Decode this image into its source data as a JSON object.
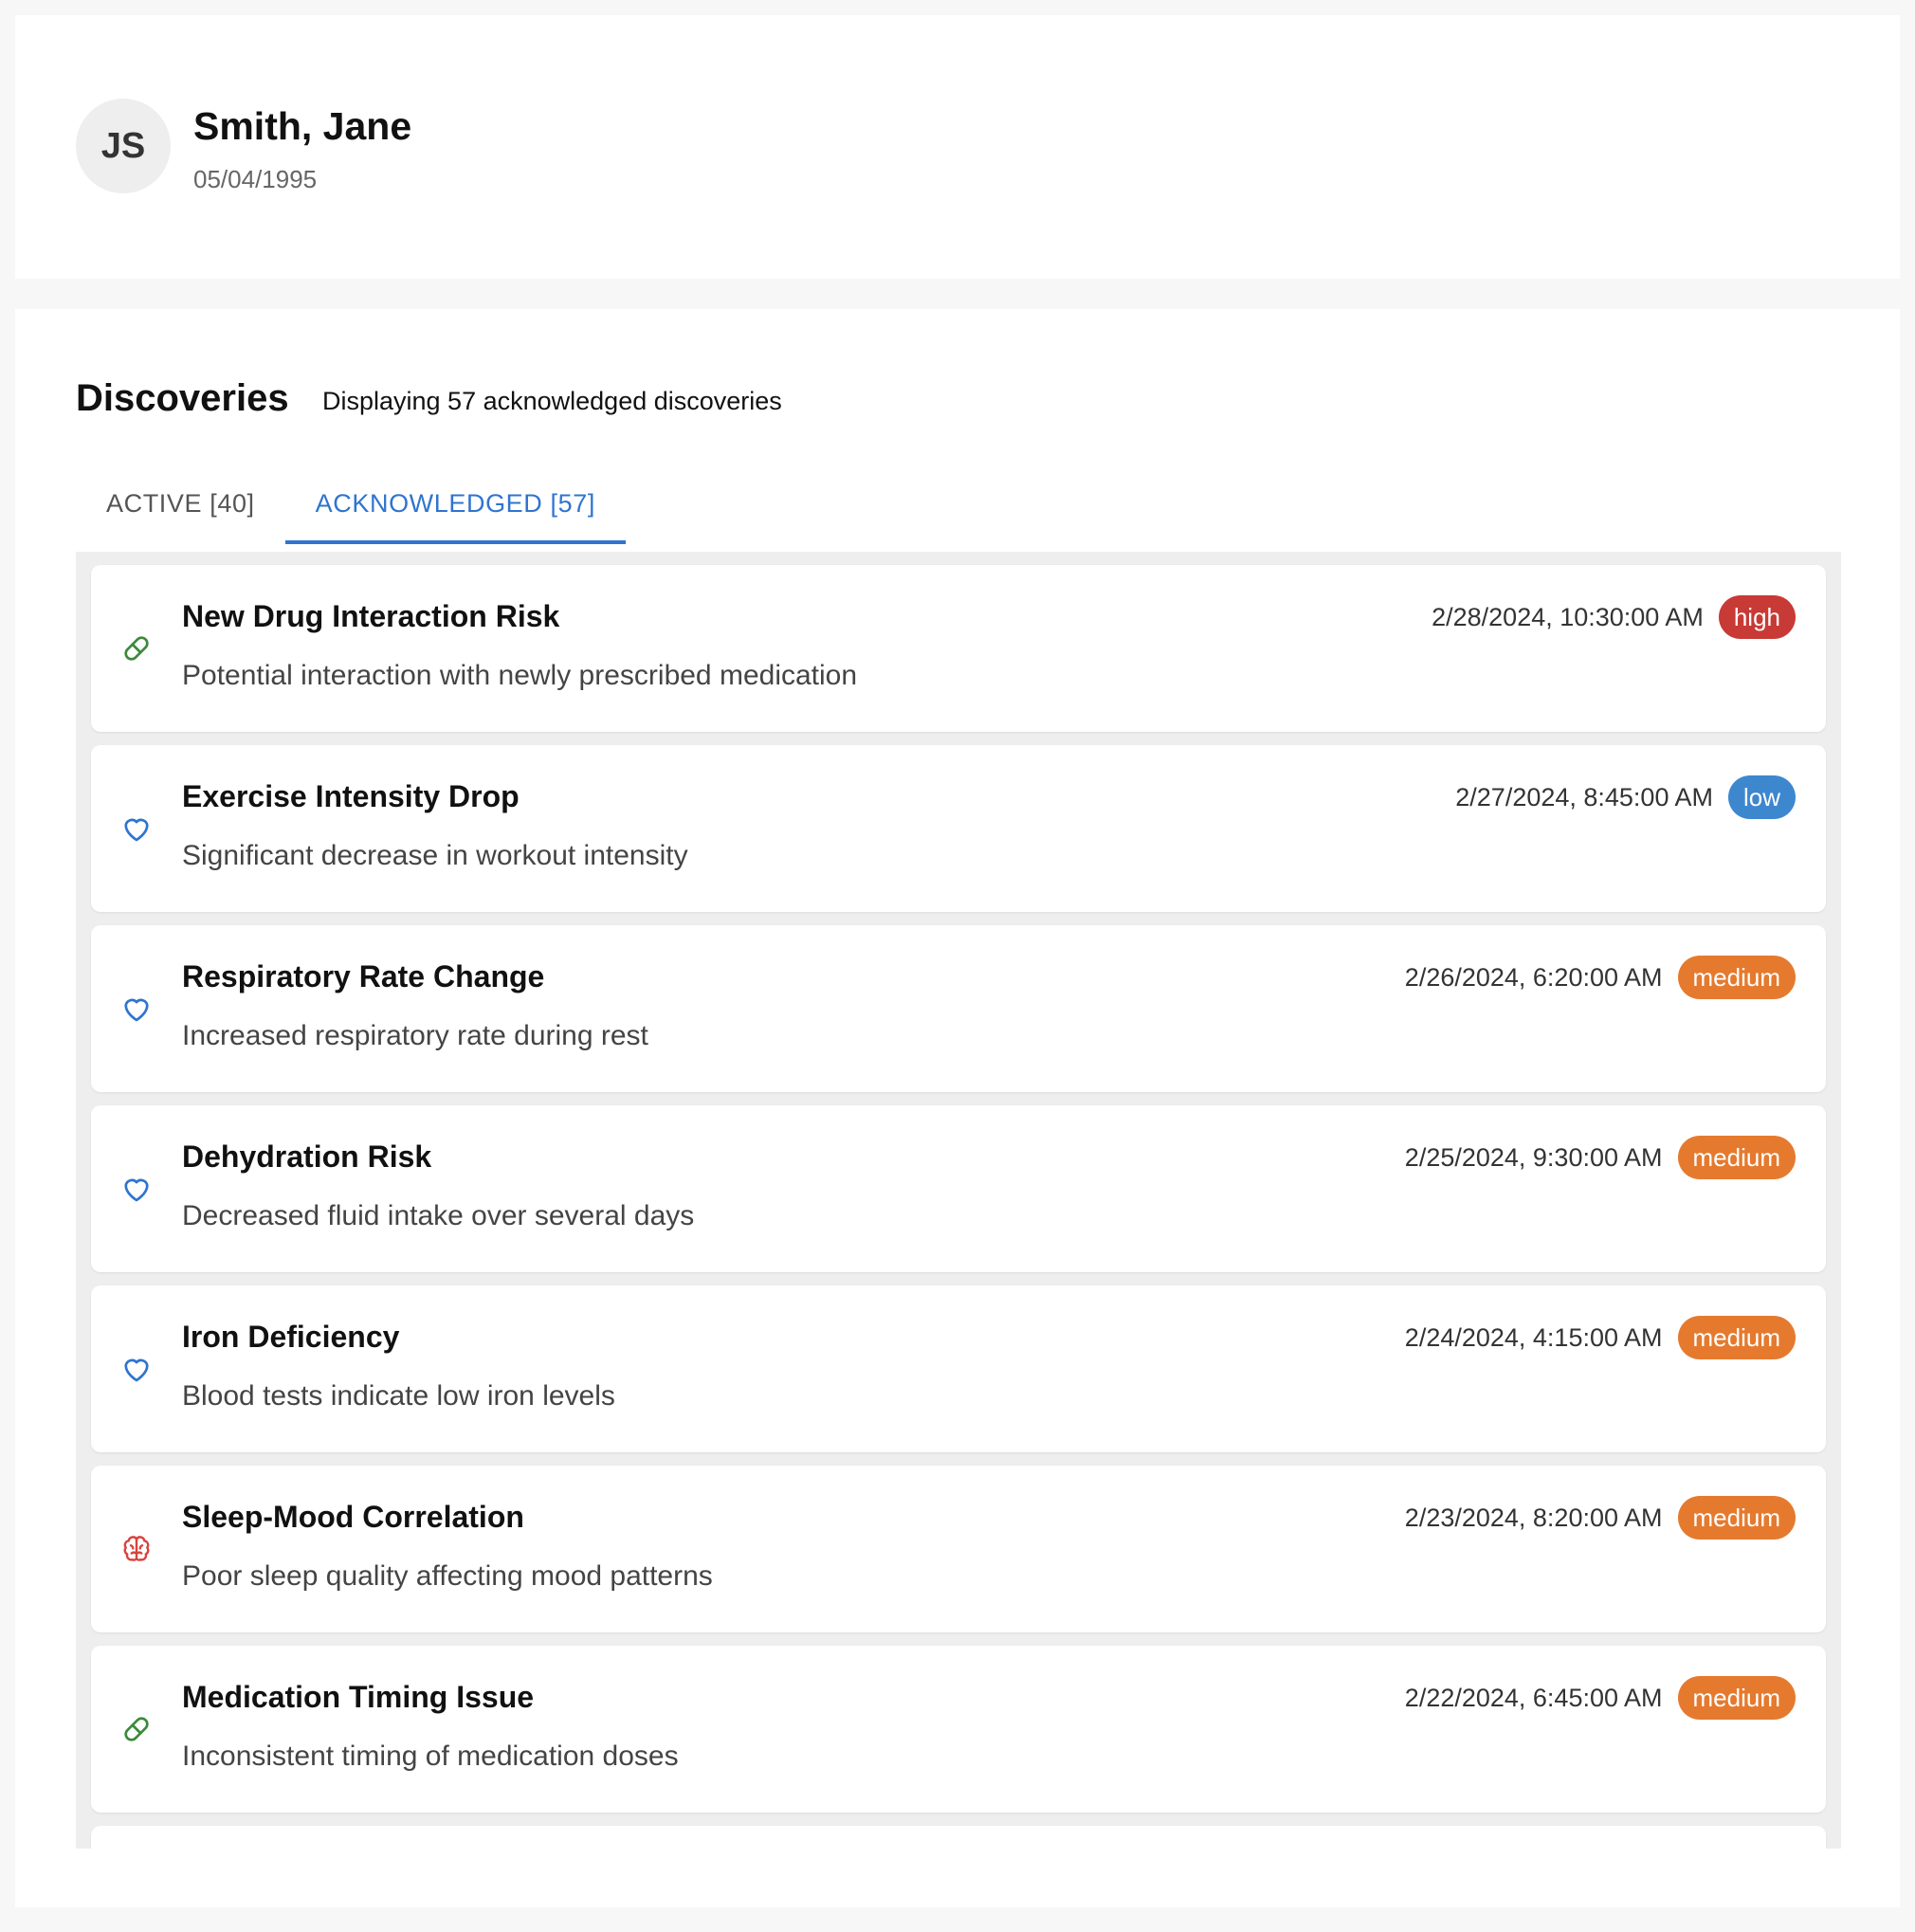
{
  "patient": {
    "initials": "JS",
    "name": "Smith, Jane",
    "dob": "05/04/1995"
  },
  "discoveries": {
    "title": "Discoveries",
    "subtitle": "Displaying 57 acknowledged discoveries",
    "tabs": [
      {
        "label": "ACTIVE [40]",
        "active": false
      },
      {
        "label": "ACKNOWLEDGED [57]",
        "active": true
      }
    ],
    "items": [
      {
        "icon": "pill-icon",
        "title": "New Drug Interaction Risk",
        "description": "Potential interaction with newly prescribed medication",
        "date": "2/28/2024, 10:30:00 AM",
        "severity": "high"
      },
      {
        "icon": "heart-icon",
        "title": "Exercise Intensity Drop",
        "description": "Significant decrease in workout intensity",
        "date": "2/27/2024, 8:45:00 AM",
        "severity": "low"
      },
      {
        "icon": "heart-icon",
        "title": "Respiratory Rate Change",
        "description": "Increased respiratory rate during rest",
        "date": "2/26/2024, 6:20:00 AM",
        "severity": "medium"
      },
      {
        "icon": "heart-icon",
        "title": "Dehydration Risk",
        "description": "Decreased fluid intake over several days",
        "date": "2/25/2024, 9:30:00 AM",
        "severity": "medium"
      },
      {
        "icon": "heart-icon",
        "title": "Iron Deficiency",
        "description": "Blood tests indicate low iron levels",
        "date": "2/24/2024, 4:15:00 AM",
        "severity": "medium"
      },
      {
        "icon": "brain-icon",
        "title": "Sleep-Mood Correlation",
        "description": "Poor sleep quality affecting mood patterns",
        "date": "2/23/2024, 8:20:00 AM",
        "severity": "medium"
      },
      {
        "icon": "pill-icon",
        "title": "Medication Timing Issue",
        "description": "Inconsistent timing of medication doses",
        "date": "2/22/2024, 6:45:00 AM",
        "severity": "medium"
      }
    ]
  },
  "colors": {
    "accent": "#2f74d0",
    "high": "#c83a36",
    "low": "#3d87cf",
    "medium": "#e57a2e",
    "pill_icon": "#3a8a3a",
    "heart_icon": "#2f74d0",
    "brain_icon": "#d9433d"
  }
}
